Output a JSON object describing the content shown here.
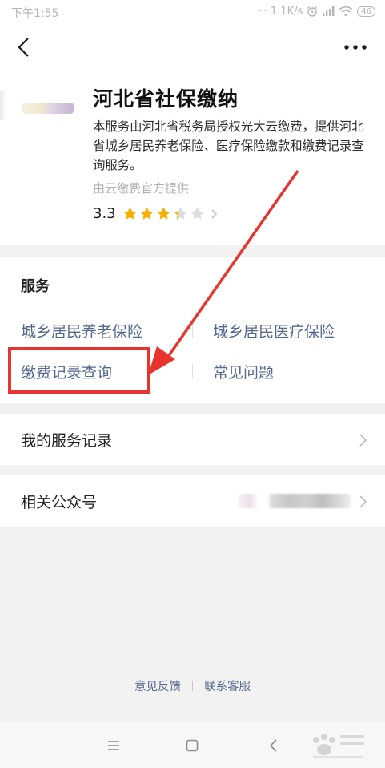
{
  "status_bar": {
    "time": "下午1:55",
    "network_speed": "1.1K/s",
    "battery": "46"
  },
  "header": {
    "back_icon": "chevron-left-icon",
    "more_icon": "more-dots-icon"
  },
  "intro": {
    "title": "河北省社保缴纳",
    "description": "本服务由河北省税务局授权光大云缴费，提供河北省城乡居民养老保险、医疗保险缴款和缴费记录查询服务。",
    "provider": "由云缴费官方提供",
    "rating": "3.3",
    "rating_value": 3.3,
    "rating_max": 5
  },
  "services": {
    "title": "服务",
    "items": [
      {
        "label": "城乡居民养老保险"
      },
      {
        "label": "城乡居民医疗保险"
      },
      {
        "label": "缴费记录查询"
      },
      {
        "label": "常见问题"
      }
    ]
  },
  "rows": {
    "service_records": "我的服务记录",
    "related_accounts": "相关公众号"
  },
  "footer": {
    "feedback": "意见反馈",
    "contact": "联系客服"
  },
  "colors": {
    "link": "#55688f",
    "star": "#f5b000",
    "annotation": "#e8342f"
  }
}
